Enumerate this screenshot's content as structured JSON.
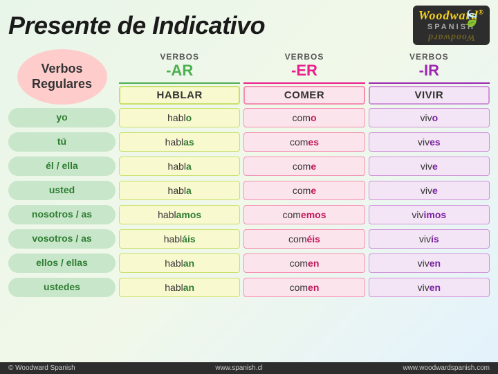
{
  "header": {
    "title": "Presente de Indicativo",
    "logo": {
      "brand": "Woodward",
      "subtitle": "SPANISH",
      "r_symbol": "®"
    }
  },
  "sidebar": {
    "label_line1": "Verbos",
    "label_line2": "Regulares"
  },
  "columns": [
    {
      "verbos_label": "VERBOS",
      "suffix": "-AR",
      "example": "HABLAR",
      "type": "ar"
    },
    {
      "verbos_label": "VERBOS",
      "suffix": "-ER",
      "example": "COMER",
      "type": "er"
    },
    {
      "verbos_label": "VERBOS",
      "suffix": "-IR",
      "example": "VIVIR",
      "type": "ir"
    }
  ],
  "rows": [
    {
      "subject": "yo",
      "ar_stem": "habl",
      "ar_end": "o",
      "er_stem": "com",
      "er_end": "o",
      "ir_stem": "viv",
      "ir_end": "o"
    },
    {
      "subject": "tú",
      "ar_stem": "habl",
      "ar_end": "as",
      "er_stem": "com",
      "er_end": "es",
      "ir_stem": "viv",
      "ir_end": "es"
    },
    {
      "subject": "él / ella",
      "ar_stem": "habl",
      "ar_end": "a",
      "er_stem": "com",
      "er_end": "e",
      "ir_stem": "viv",
      "ir_end": "e"
    },
    {
      "subject": "usted",
      "ar_stem": "habl",
      "ar_end": "a",
      "er_stem": "com",
      "er_end": "e",
      "ir_stem": "viv",
      "ir_end": "e"
    },
    {
      "subject": "nosotros / as",
      "ar_stem": "habl",
      "ar_end": "amos",
      "er_stem": "com",
      "er_end": "emos",
      "ir_stem": "viv",
      "ir_end": "imos"
    },
    {
      "subject": "vosotros / as",
      "ar_stem": "habl",
      "ar_end": "áis",
      "er_stem": "com",
      "er_end": "éis",
      "ir_stem": "viv",
      "ir_end": "ís"
    },
    {
      "subject": "ellos / ellas",
      "ar_stem": "habl",
      "ar_end": "an",
      "er_stem": "com",
      "er_end": "en",
      "ir_stem": "viv",
      "ir_end": "en"
    },
    {
      "subject": "ustedes",
      "ar_stem": "habl",
      "ar_end": "an",
      "er_stem": "com",
      "er_end": "en",
      "ir_stem": "viv",
      "ir_end": "en"
    }
  ],
  "footer": {
    "copyright": "© Woodward Spanish",
    "website1": "www.spanish.cl",
    "website2": "www.woodwardspanish.com"
  }
}
